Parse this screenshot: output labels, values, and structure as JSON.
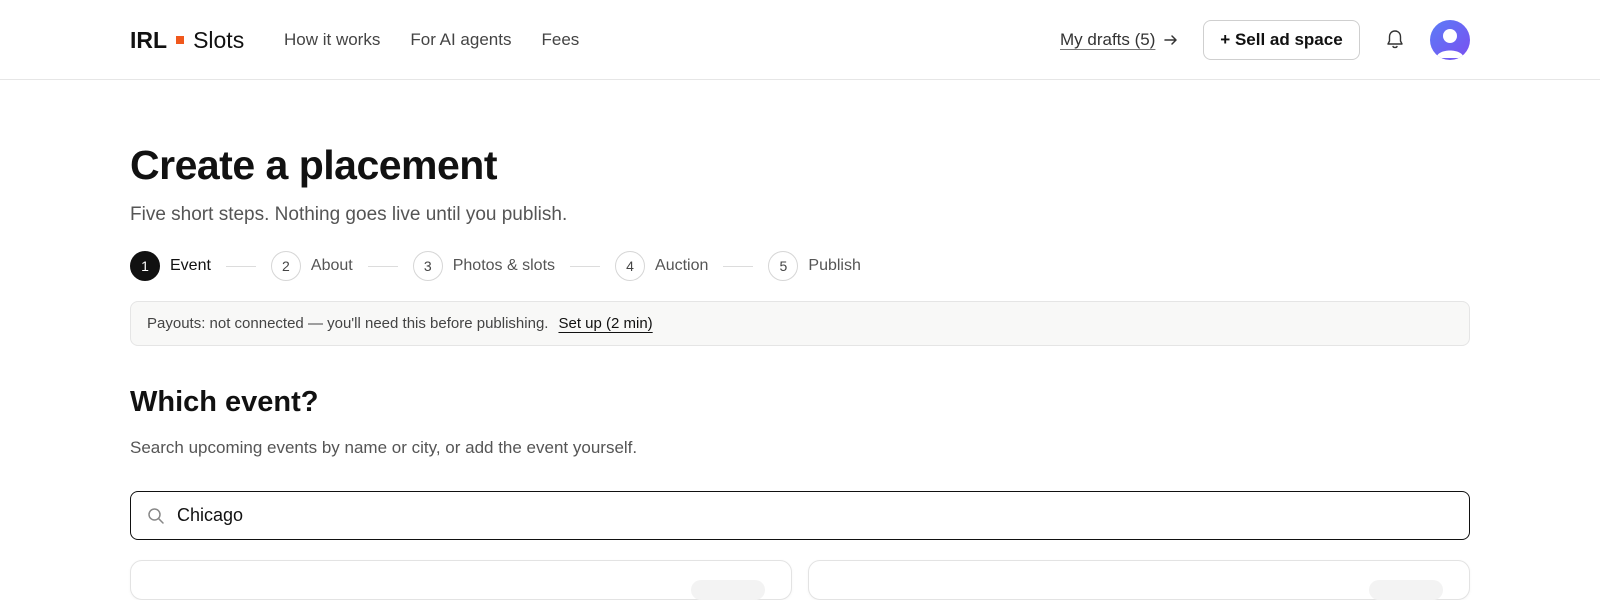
{
  "header": {
    "brand_primary": "IRL",
    "brand_secondary": "Slots",
    "brand_accent": "#f0581c",
    "nav": [
      {
        "label": "How it works"
      },
      {
        "label": "For AI agents"
      },
      {
        "label": "Fees"
      }
    ],
    "drafts_label": "My drafts (5)",
    "drafts_icon": "arrow-right-icon",
    "sell_label": "+ Sell ad space",
    "bell_icon": "bell-icon",
    "avatar_icon": "user-avatar-icon"
  },
  "main": {
    "title": "Create a placement",
    "subtitle": "Five short steps. Nothing goes live until you publish.",
    "steps": [
      {
        "num": "1",
        "label": "Event",
        "active": true
      },
      {
        "num": "2",
        "label": "About",
        "active": false
      },
      {
        "num": "3",
        "label": "Photos & slots",
        "active": false
      },
      {
        "num": "4",
        "label": "Auction",
        "active": false
      },
      {
        "num": "5",
        "label": "Publish",
        "active": false
      }
    ],
    "banner": {
      "text": "Payouts: not connected — you'll need this before publishing.",
      "link": "Set up (2 min)"
    },
    "section": {
      "title": "Which event?",
      "description": "Search upcoming events by name or city, or add the event yourself.",
      "search_icon": "search-icon",
      "search_value": "Chicago"
    }
  },
  "colors": {
    "text": "#111111",
    "muted": "#555555",
    "border": "#e5e5e5",
    "avatar_gradient_start": "#5b7cf7",
    "avatar_gradient_end": "#7a4ff0"
  }
}
